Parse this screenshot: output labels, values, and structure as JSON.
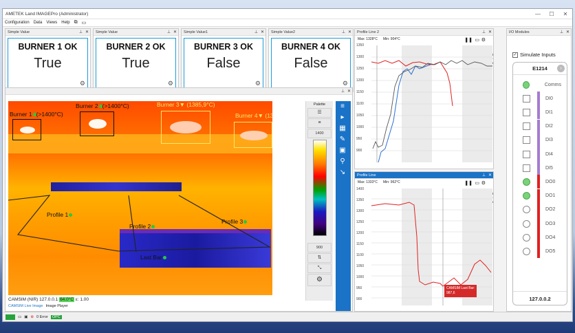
{
  "window": {
    "title": "AMETEK Land IMAGEPro (Administrator)",
    "controls": [
      "—",
      "☐",
      "✕"
    ]
  },
  "menu": [
    "Configuration",
    "Data",
    "Views",
    "Help"
  ],
  "simple_values": [
    {
      "panel_title": "Simple Value",
      "label": "BURNER 1 OK",
      "value": "True"
    },
    {
      "panel_title": "Simple Value",
      "label": "BURNER 2 OK",
      "value": "True"
    },
    {
      "panel_title": "Simple Value1",
      "label": "BURNER 3 OK",
      "value": "False"
    },
    {
      "panel_title": "Simple Value2",
      "label": "BURNER 4 OK",
      "value": "False"
    }
  ],
  "image_panel": {
    "palette_label": "Palette",
    "scale_max": "1400",
    "scale_min": "900",
    "annotations": {
      "burner1": "Burner 1",
      "burner1_cond": "(>1400°C)",
      "burner2": "Burner 2",
      "burner2_cond": "(>1400°C)",
      "burner3": "Burner 3▼ (1385,9°C)",
      "burner4": "Burner 4▼ (13",
      "profile1": "Profile 1",
      "profile2": "Profile 2",
      "profile3": "Profile 3",
      "last_bar": "Last Bar"
    },
    "status_text": "CAMSIM (NIR) 127.0.0.1",
    "status_temp": "64.0°C",
    "status_emissivity": "ε: 1.00",
    "tabs": [
      "CAMSIM Live Image",
      "Image Player"
    ]
  },
  "profile_line2": {
    "title": "Profile Line 2",
    "max": "Max: 1328°C",
    "min": "Min: 904°C",
    "side_label": "Data Sources",
    "y_ticks": [
      "1350",
      "1300",
      "1250",
      "1200",
      "1150",
      "1100",
      "1050",
      "1000",
      "950",
      "900"
    ]
  },
  "profile_line": {
    "title": "Profile Line",
    "max": "Max: 1333°C",
    "min": "Min: 962°C",
    "side_label": "Data Sources",
    "y_ticks": [
      "1400",
      "1350",
      "1300",
      "1250",
      "1200",
      "1150",
      "1100",
      "1050",
      "1000",
      "950",
      "900"
    ],
    "tooltip_line1": "CAMSIM Last Bar:",
    "tooltip_line2": "987,6"
  },
  "io_modules": {
    "title": "I/O Modules",
    "simulate_label": "Simulate Inputs",
    "module_name": "E1214",
    "rows": [
      {
        "name": "Comms",
        "kind": "circle",
        "on": true,
        "bar": "none"
      },
      {
        "name": "DI0",
        "kind": "square",
        "on": false,
        "bar": "#a57bd1"
      },
      {
        "name": "DI1",
        "kind": "square",
        "on": false,
        "bar": "#a57bd1"
      },
      {
        "name": "DI2",
        "kind": "square",
        "on": false,
        "bar": "#a57bd1"
      },
      {
        "name": "DI3",
        "kind": "square",
        "on": false,
        "bar": "#a57bd1"
      },
      {
        "name": "DI4",
        "kind": "square",
        "on": false,
        "bar": "#a57bd1"
      },
      {
        "name": "DI5",
        "kind": "square",
        "on": false,
        "bar": "#a57bd1"
      },
      {
        "name": "DO0",
        "kind": "circle",
        "on": true,
        "bar": "#e02020"
      },
      {
        "name": "DO1",
        "kind": "circle",
        "on": true,
        "bar": "#e02020"
      },
      {
        "name": "DO2",
        "kind": "circle",
        "on": false,
        "bar": "#e02020"
      },
      {
        "name": "DO3",
        "kind": "circle",
        "on": false,
        "bar": "#e02020"
      },
      {
        "name": "DO4",
        "kind": "circle",
        "on": false,
        "bar": "#e02020"
      },
      {
        "name": "DO5",
        "kind": "circle",
        "on": false,
        "bar": "#e02020"
      }
    ],
    "ip": "127.0.0.2"
  },
  "statusbar": {
    "errors": "0 Error",
    "opc": "OPC"
  },
  "colors": {
    "accent": "#1a73c7",
    "cyan_border": "#1a9ad6",
    "ok_green": "#7ad27a",
    "alarm_red": "#e02020"
  }
}
